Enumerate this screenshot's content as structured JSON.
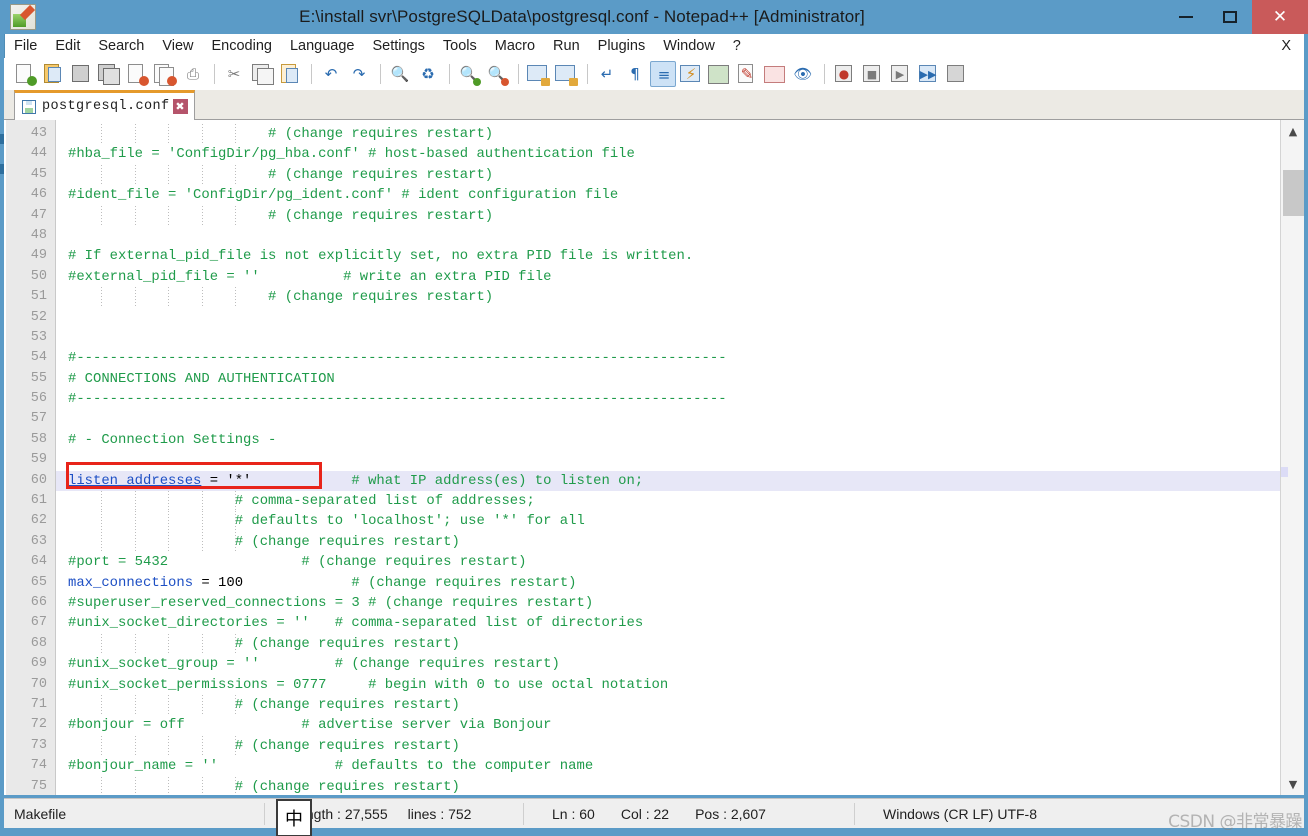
{
  "window": {
    "title": "E:\\install svr\\PostgreSQLData\\postgresql.conf - Notepad++ [Administrator]",
    "app_icon": "notepad-plus-plus-icon",
    "minimize_label": "–",
    "maximize_label": "□",
    "close_label": "✕",
    "titlebar_color": "#5b9bc7",
    "close_button_color": "#c95a5a"
  },
  "menubar": {
    "items": [
      "File",
      "Edit",
      "Search",
      "View",
      "Encoding",
      "Language",
      "Settings",
      "Tools",
      "Macro",
      "Run",
      "Plugins",
      "Window",
      "?"
    ],
    "close_document_label": "X"
  },
  "toolbar": {
    "icons": [
      "new-file-icon",
      "open-file-icon",
      "save-icon",
      "save-all-icon",
      "close-file-icon",
      "close-all-files-icon",
      "print-icon",
      "cut-icon",
      "copy-icon",
      "paste-icon",
      "undo-icon",
      "redo-icon",
      "find-icon",
      "replace-icon",
      "zoom-in-icon",
      "zoom-out-icon",
      "sync-vertical-scroll-icon",
      "sync-horizontal-scroll-icon",
      "word-wrap-icon",
      "show-all-characters-icon",
      "indent-guideline-icon",
      "user-defined-language-icon",
      "show-document-map-icon",
      "function-list-icon",
      "folder-as-workspace-icon",
      "monitoring-icon",
      "record-macro-icon",
      "stop-recording-icon",
      "playback-macro-icon",
      "run-macro-multiple-icon",
      "run-icon"
    ],
    "selected_icon": "indent-guideline-icon"
  },
  "tab": {
    "label": "postgresql.conf",
    "save_icon": "saved-file-icon",
    "close_label": "✖",
    "active_accent_color": "#e59a2b"
  },
  "editor": {
    "first_line_number": 43,
    "current_line": 60,
    "current_line_highlight_color": "#e7e7f7",
    "comment_color": "#1f9b4a",
    "keyword_color": "#1d4fc4",
    "annotation_box_color": "#e8241a",
    "lines": [
      {
        "n": 43,
        "indent": 5,
        "spans": [
          {
            "t": "                        # (change requires restart)",
            "c": "cm"
          }
        ]
      },
      {
        "n": 44,
        "indent": 0,
        "spans": [
          {
            "t": "#hba_file = 'ConfigDir/pg_hba.conf' # host-based authentication file",
            "c": "cm"
          }
        ]
      },
      {
        "n": 45,
        "indent": 5,
        "spans": [
          {
            "t": "                        # (change requires restart)",
            "c": "cm"
          }
        ]
      },
      {
        "n": 46,
        "indent": 0,
        "spans": [
          {
            "t": "#ident_file = 'ConfigDir/pg_ident.conf' # ident configuration file",
            "c": "cm"
          }
        ]
      },
      {
        "n": 47,
        "indent": 5,
        "spans": [
          {
            "t": "                        # (change requires restart)",
            "c": "cm"
          }
        ]
      },
      {
        "n": 48,
        "indent": 0,
        "spans": [
          {
            "t": "",
            "c": "pl"
          }
        ]
      },
      {
        "n": 49,
        "indent": 0,
        "spans": [
          {
            "t": "# If external_pid_file is not explicitly set, no extra PID file is written.",
            "c": "cm"
          }
        ]
      },
      {
        "n": 50,
        "indent": 0,
        "spans": [
          {
            "t": "#external_pid_file = ''          # write an extra PID file",
            "c": "cm"
          }
        ]
      },
      {
        "n": 51,
        "indent": 5,
        "spans": [
          {
            "t": "                        # (change requires restart)",
            "c": "cm"
          }
        ]
      },
      {
        "n": 52,
        "indent": 0,
        "spans": [
          {
            "t": "",
            "c": "pl"
          }
        ]
      },
      {
        "n": 53,
        "indent": 0,
        "spans": [
          {
            "t": "",
            "c": "pl"
          }
        ]
      },
      {
        "n": 54,
        "indent": 0,
        "spans": [
          {
            "t": "#------------------------------------------------------------------------------",
            "c": "cm"
          }
        ]
      },
      {
        "n": 55,
        "indent": 0,
        "spans": [
          {
            "t": "# CONNECTIONS AND AUTHENTICATION",
            "c": "cm"
          }
        ]
      },
      {
        "n": 56,
        "indent": 0,
        "spans": [
          {
            "t": "#------------------------------------------------------------------------------",
            "c": "cm"
          }
        ]
      },
      {
        "n": 57,
        "indent": 0,
        "spans": [
          {
            "t": "",
            "c": "pl"
          }
        ]
      },
      {
        "n": 58,
        "indent": 0,
        "spans": [
          {
            "t": "# - Connection Settings -",
            "c": "cm"
          }
        ]
      },
      {
        "n": 59,
        "indent": 0,
        "spans": [
          {
            "t": "",
            "c": "pl"
          }
        ]
      },
      {
        "n": 60,
        "indent": 0,
        "current": true,
        "spans": [
          {
            "t": "listen_addresses",
            "c": "kwu"
          },
          {
            "t": " = '*'            ",
            "c": "pl"
          },
          {
            "t": "# what IP address(es) to listen on;",
            "c": "cm"
          }
        ]
      },
      {
        "n": 61,
        "indent": 5,
        "spans": [
          {
            "t": "                    # comma-separated list of addresses;",
            "c": "cm"
          }
        ]
      },
      {
        "n": 62,
        "indent": 5,
        "spans": [
          {
            "t": "                    # defaults to 'localhost'; use '*' for all",
            "c": "cm"
          }
        ]
      },
      {
        "n": 63,
        "indent": 5,
        "spans": [
          {
            "t": "                    # (change requires restart)",
            "c": "cm"
          }
        ]
      },
      {
        "n": 64,
        "indent": 0,
        "spans": [
          {
            "t": "#port = 5432                # (change requires restart)",
            "c": "cm"
          }
        ]
      },
      {
        "n": 65,
        "indent": 0,
        "spans": [
          {
            "t": "max_connections",
            "c": "kw"
          },
          {
            "t": " = 100",
            "c": "pl"
          },
          {
            "t": "             # (change requires restart)",
            "c": "cm"
          }
        ]
      },
      {
        "n": 66,
        "indent": 0,
        "spans": [
          {
            "t": "#superuser_reserved_connections = 3 # (change requires restart)",
            "c": "cm"
          }
        ]
      },
      {
        "n": 67,
        "indent": 0,
        "spans": [
          {
            "t": "#unix_socket_directories = ''   # comma-separated list of directories",
            "c": "cm"
          }
        ]
      },
      {
        "n": 68,
        "indent": 5,
        "spans": [
          {
            "t": "                    # (change requires restart)",
            "c": "cm"
          }
        ]
      },
      {
        "n": 69,
        "indent": 0,
        "spans": [
          {
            "t": "#unix_socket_group = ''         # (change requires restart)",
            "c": "cm"
          }
        ]
      },
      {
        "n": 70,
        "indent": 0,
        "spans": [
          {
            "t": "#unix_socket_permissions = 0777     # begin with 0 to use octal notation",
            "c": "cm"
          }
        ]
      },
      {
        "n": 71,
        "indent": 5,
        "spans": [
          {
            "t": "                    # (change requires restart)",
            "c": "cm"
          }
        ]
      },
      {
        "n": 72,
        "indent": 0,
        "spans": [
          {
            "t": "#bonjour = off              # advertise server via Bonjour",
            "c": "cm"
          }
        ]
      },
      {
        "n": 73,
        "indent": 5,
        "spans": [
          {
            "t": "                    # (change requires restart)",
            "c": "cm"
          }
        ]
      },
      {
        "n": 74,
        "indent": 0,
        "spans": [
          {
            "t": "#bonjour_name = ''              # defaults to the computer name",
            "c": "cm"
          }
        ]
      },
      {
        "n": 75,
        "indent": 5,
        "spans": [
          {
            "t": "                    # (change requires restart)",
            "c": "cm"
          }
        ]
      }
    ]
  },
  "scrollbar": {
    "up_arrow": "▲",
    "down_arrow": "▼"
  },
  "statusbar": {
    "language": "Makefile",
    "ime_indicator": "中",
    "length_label": "length : 27,555",
    "lines_label": "lines : 752",
    "ln": "Ln : 60",
    "col": "Col : 22",
    "pos": "Pos : 2,607",
    "encoding": "Windows (CR LF)    UTF-8",
    "watermark": "CSDN @非常暴躁"
  }
}
